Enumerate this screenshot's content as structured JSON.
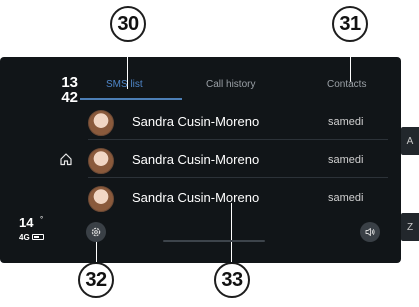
{
  "callouts": {
    "c30": "30",
    "c31": "31",
    "c32": "32",
    "c33": "33"
  },
  "clock": {
    "hours": "13",
    "minutes": "42"
  },
  "tabs": [
    {
      "label": "SMS list",
      "active": true
    },
    {
      "label": "Call history",
      "active": false
    },
    {
      "label": "Contacts",
      "active": false
    }
  ],
  "messages": [
    {
      "name": "Sandra Cusin-Moreno",
      "date": "samedi"
    },
    {
      "name": "Sandra Cusin-Moreno",
      "date": "samedi"
    },
    {
      "name": "Sandra Cusin-Moreno",
      "date": "samedi"
    }
  ],
  "alpha_index": {
    "top": "A",
    "bottom": "Z"
  },
  "status": {
    "temperature": "14",
    "degree": "°",
    "network": "4G"
  },
  "icons": {
    "home": "home-icon",
    "settings": "gear-icon",
    "volume": "speaker-icon"
  },
  "colors": {
    "background": "#111518",
    "active_tab": "#4f86c9",
    "text": "#ffffff"
  }
}
